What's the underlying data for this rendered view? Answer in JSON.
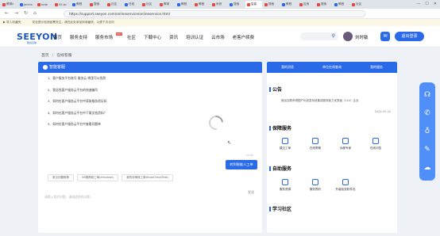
{
  "browser": {
    "tabs": [
      {
        "label": "教育ii",
        "active": false
      },
      {
        "label": "Jenkin",
        "active": false
      },
      {
        "label": "Inde",
        "active": false
      },
      {
        "label": "55.bc",
        "active": false
      },
      {
        "label": "教程",
        "active": false
      },
      {
        "label": "搜索",
        "active": false
      },
      {
        "label": "社区",
        "active": false
      },
      {
        "label": "在线",
        "active": false
      },
      {
        "label": "社区",
        "active": false
      },
      {
        "label": "教育",
        "active": false
      },
      {
        "label": "教程",
        "active": false
      },
      {
        "label": "教程",
        "active": false
      },
      {
        "label": "系统",
        "active": false
      },
      {
        "label": "搜索",
        "active": false
      },
      {
        "label": "智能",
        "active": true
      },
      {
        "label": "搜索",
        "active": false
      },
      {
        "label": "教程",
        "active": false
      },
      {
        "label": "应用",
        "active": false
      },
      {
        "label": "搜索",
        "active": false
      },
      {
        "label": "教程",
        "active": false
      },
      {
        "label": "社区",
        "active": false
      }
    ],
    "url": "https://support.seeyon.com/onlineservice/onlineservice.html",
    "notice_left": "▶ 导入收藏夹",
    "notice_text": "安全提示检测如需关注，请在此处添加到收藏夹，以便下次访问"
  },
  "header": {
    "logo": "SEEYON",
    "logo_sub": "致远互联",
    "nav": [
      "首页",
      "服务支持",
      "服务市场",
      "社区",
      "下载中心",
      "资讯",
      "培训认证",
      "云市场",
      "老客户续费"
    ],
    "hot_badge": "HOT",
    "username": "刘时敏",
    "login_button": "退出登录"
  },
  "breadcrumb": [
    "首页",
    "在线客服"
  ],
  "chat": {
    "title": "智能客服",
    "questions": [
      "1、客户服务平台账号 服务云 哪里可以找到",
      "2、我总找客户服务云平台的快速编号",
      "3、如何在客户服务云平台中获取服务验证码",
      "4、如何在客户服务云平台中下载文档资料？",
      "5、如何在客户服务云平台中查看问题单"
    ],
    "time": "10:00",
    "manual_button": "转到智能人工单",
    "quick_buttons": [
      "常见问题推荐",
      "V8推荐新工单(ehnctest)",
      "我的待审核工单(fromCheckTest)"
    ],
    "input_placeholder": "请输入您的问题，请描述您的问题...",
    "send_label": "发送"
  },
  "right_panel": {
    "tabs": [
      "我的消息",
      "单位在线查询",
      "我的服务"
    ],
    "announce_title": "公告",
    "announce_text": "致远互联获得国产化信息系统集成服务能力优秀级（L14）企业",
    "announce_date": "2024-03-20",
    "service_title": "保障服务",
    "service_items": [
      "建交工单",
      "在线帮助",
      "远程专家",
      "在线问答"
    ],
    "self_title": "自助服务",
    "self_items": [
      "服务资源",
      "服务预约",
      "升级检查软件包"
    ],
    "study_title": "学习社区"
  },
  "colors": {
    "accent": "#2a6ae9",
    "hot": "#f0463c"
  }
}
